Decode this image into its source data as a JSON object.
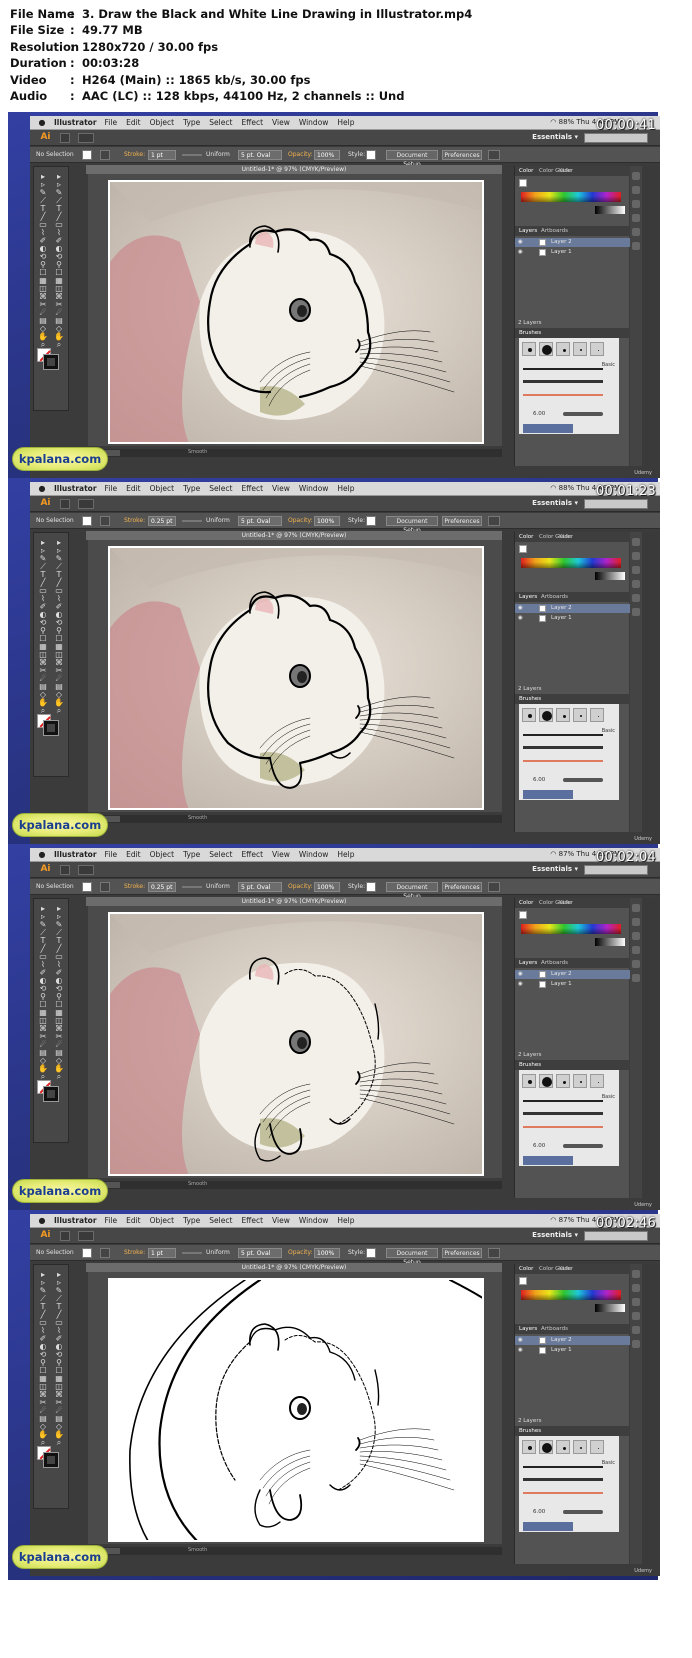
{
  "meta": [
    {
      "key": "File Name",
      "value": "3. Draw the Black and White Line Drawing in Illustrator.mp4"
    },
    {
      "key": "File Size",
      "value": "49.77 MB"
    },
    {
      "key": "Resolution",
      "value": "1280x720 / 30.00 fps"
    },
    {
      "key": "Duration",
      "value": "00:03:28"
    },
    {
      "key": "Video",
      "value": "H264 (Main) :: 1865 kb/s, 30.00 fps"
    },
    {
      "key": "Audio",
      "value": "AAC (LC) :: 128 kbps, 44100 Hz, 2 channels :: Und"
    }
  ],
  "meta_sep": ":",
  "menu": {
    "app": "Illustrator",
    "items": [
      "File",
      "Edit",
      "Object",
      "Type",
      "Select",
      "Effect",
      "View",
      "Window",
      "Help"
    ]
  },
  "appbar": {
    "logo": "Ai",
    "workspace": "Essentials ▾"
  },
  "control": {
    "selection": "No Selection",
    "stroke_label": "Stroke:",
    "profile": "Uniform",
    "brush": "5 pt. Oval",
    "opacity_label": "Opacity:",
    "opacity": "100%",
    "style_label": "Style:",
    "doc_setup": "Document Setup",
    "prefs": "Preferences"
  },
  "doc_title": "Untitled-1* @ 97% (CMYK/Preview)",
  "panels": {
    "color_tabs": [
      "Color",
      "Color Guide",
      "Kuler"
    ],
    "layer_tabs": [
      "Layers",
      "Artboards"
    ],
    "layers": [
      "Layer 2",
      "Layer 1"
    ],
    "layer_count": "2 Layers",
    "brushes_tab": "Brushes",
    "brush_basic": "Basic",
    "brush_size": "6.00"
  },
  "status": {
    "tool": "Smooth"
  },
  "watermark": "kpalana.com",
  "udemy": "Udemy",
  "frames": [
    {
      "time": "Thu 4:48 PM",
      "battery": "88%",
      "timecode": "00:00:41",
      "stroke_weight": "1 pt",
      "stage": 1
    },
    {
      "time": "Thu 4:49 PM",
      "battery": "88%",
      "timecode": "00:01:23",
      "stroke_weight": "0.25 pt",
      "stage": 2
    },
    {
      "time": "Thu 4:50 PM",
      "battery": "87%",
      "timecode": "00:02:04",
      "stroke_weight": "0.25 pt",
      "stage": 3
    },
    {
      "time": "Thu 4:50 PM",
      "battery": "87%",
      "timecode": "00:02:46",
      "stroke_weight": "1 pt",
      "stage": 4
    }
  ],
  "colors": {
    "frame_bg": "#2e3a8c",
    "accent": "#f59a23",
    "stroke_label": "#f2b34f",
    "watermark": "#1b3e8e"
  }
}
